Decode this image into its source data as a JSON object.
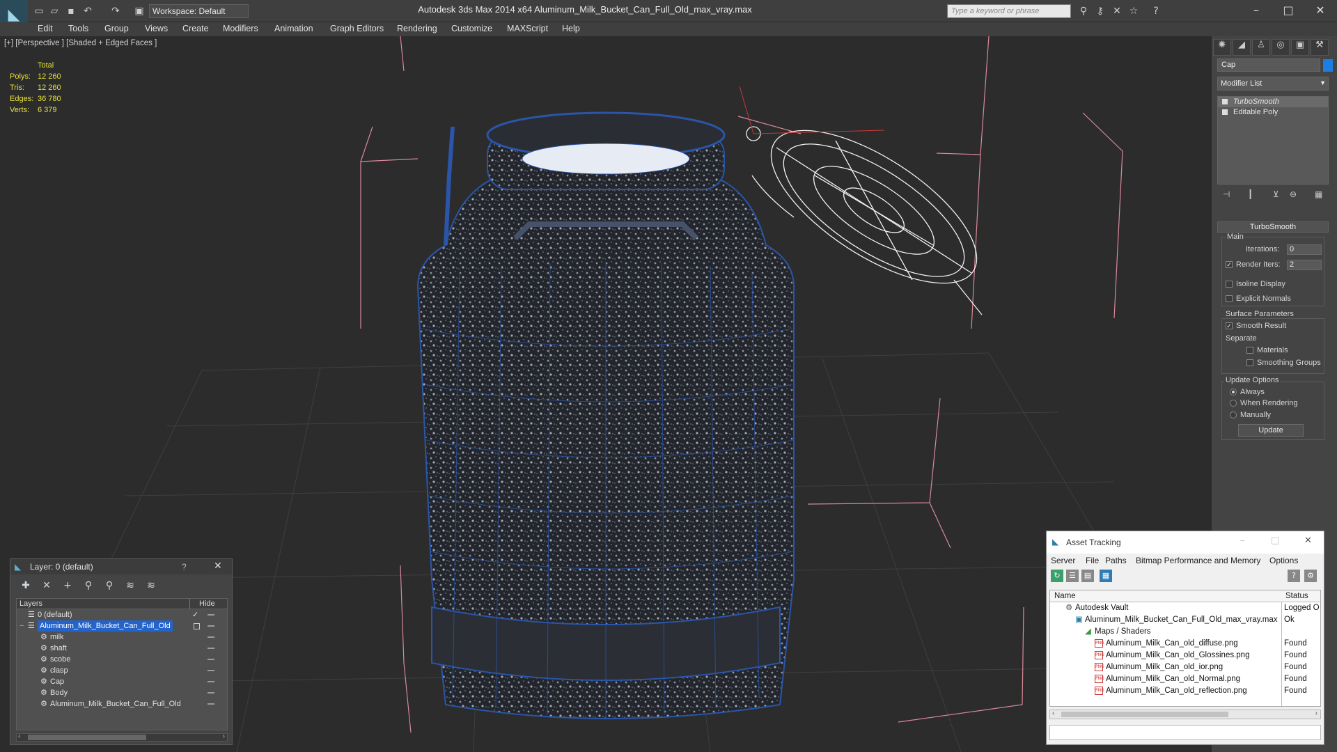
{
  "app": {
    "title": "Autodesk 3ds Max  2014 x64     Aluminum_Milk_Bucket_Can_Full_Old_max_vray.max",
    "workspace": "Workspace: Default",
    "search_placeholder": "Type a keyword or phrase"
  },
  "menu": [
    "Edit",
    "Tools",
    "Group",
    "Views",
    "Create",
    "Modifiers",
    "Animation",
    "Graph Editors",
    "Rendering",
    "Customize",
    "MAXScript",
    "Help"
  ],
  "viewport": {
    "label": "[+] [Perspective ] [Shaded + Edged Faces ]",
    "stats": {
      "header": "Total",
      "rows": [
        {
          "k": "Polys:",
          "v": "12 260"
        },
        {
          "k": "Tris:",
          "v": "12 260"
        },
        {
          "k": "Edges:",
          "v": "36 780"
        },
        {
          "k": "Verts:",
          "v": "6 379"
        }
      ]
    }
  },
  "command_panel": {
    "object_name": "Cap",
    "object_color": "#1b7ee0",
    "modifier_list": "Modifier List",
    "stack": [
      "TurboSmooth",
      "Editable Poly"
    ],
    "rollout_title": "TurboSmooth",
    "main_label": "Main",
    "iterations_label": "Iterations:",
    "iterations_value": "0",
    "render_iters_label": "Render Iters:",
    "render_iters_value": "2",
    "isoline": "Isoline Display",
    "explicit": "Explicit Normals",
    "surface_label": "Surface Parameters",
    "smooth_result": "Smooth Result",
    "separate": "Separate",
    "materials": "Materials",
    "smoothing_groups": "Smoothing Groups",
    "update_options": "Update Options",
    "always": "Always",
    "when_rendering": "When Rendering",
    "manually": "Manually",
    "update_btn": "Update"
  },
  "layer_window": {
    "title": "Layer: 0 (default)",
    "help": "?",
    "col_layers": "Layers",
    "col_hide": "Hide",
    "rows": [
      {
        "name": "0 (default)",
        "indent": 0,
        "check": true
      },
      {
        "name": "Aluminum_Milk_Bucket_Can_Full_Old",
        "indent": 0,
        "selected": true
      },
      {
        "name": "milk",
        "indent": 1
      },
      {
        "name": "shaft",
        "indent": 1
      },
      {
        "name": "scobe",
        "indent": 1
      },
      {
        "name": "clasp",
        "indent": 1
      },
      {
        "name": "Cap",
        "indent": 1
      },
      {
        "name": "Body",
        "indent": 1
      },
      {
        "name": "Aluminum_Milk_Bucket_Can_Full_Old",
        "indent": 1
      }
    ]
  },
  "asset_tracking": {
    "title": "Asset Tracking",
    "menu": [
      "Server",
      "File",
      "Paths",
      "Bitmap Performance and Memory",
      "Options"
    ],
    "col_name": "Name",
    "col_status": "Status",
    "rows": [
      {
        "name": "Autodesk Vault",
        "status": "Logged O",
        "indent": 1,
        "icon": "vault"
      },
      {
        "name": "Aluminum_Milk_Bucket_Can_Full_Old_max_vray.max",
        "status": "Ok",
        "indent": 2,
        "icon": "max"
      },
      {
        "name": "Maps / Shaders",
        "status": "",
        "indent": 3,
        "icon": "maps"
      },
      {
        "name": "Aluminum_Milk_Can_old_diffuse.png",
        "status": "Found",
        "indent": 4,
        "icon": "png"
      },
      {
        "name": "Aluminum_Milk_Can_old_Glossines.png",
        "status": "Found",
        "indent": 4,
        "icon": "png"
      },
      {
        "name": "Aluminum_Milk_Can_old_ior.png",
        "status": "Found",
        "indent": 4,
        "icon": "png"
      },
      {
        "name": "Aluminum_Milk_Can_old_Normal.png",
        "status": "Found",
        "indent": 4,
        "icon": "png"
      },
      {
        "name": "Aluminum_Milk_Can_old_reflection.png",
        "status": "Found",
        "indent": 4,
        "icon": "png"
      }
    ]
  }
}
